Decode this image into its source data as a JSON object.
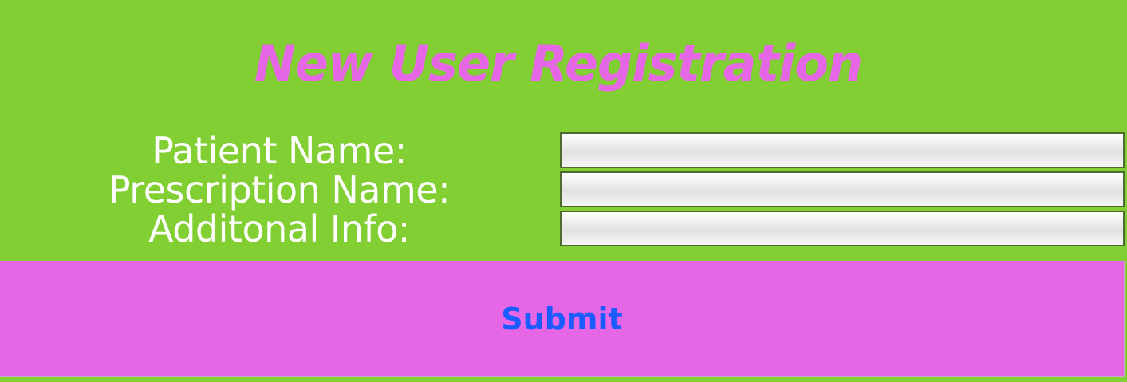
{
  "app": {
    "title": "New User Registration"
  },
  "form": {
    "fields": [
      {
        "label": "Patient Name:",
        "value": "",
        "placeholder": ""
      },
      {
        "label": "Prescription Name:",
        "value": "",
        "placeholder": ""
      },
      {
        "label": "Additonal Info:",
        "value": "",
        "placeholder": ""
      }
    ],
    "submit_label": "Submit"
  },
  "colors": {
    "background": "#82cf34",
    "title": "#e667e6",
    "label": "#ffffff",
    "button_bg": "#e667e6",
    "button_text": "#1a5cff",
    "field_border": "#4f6b2d"
  }
}
